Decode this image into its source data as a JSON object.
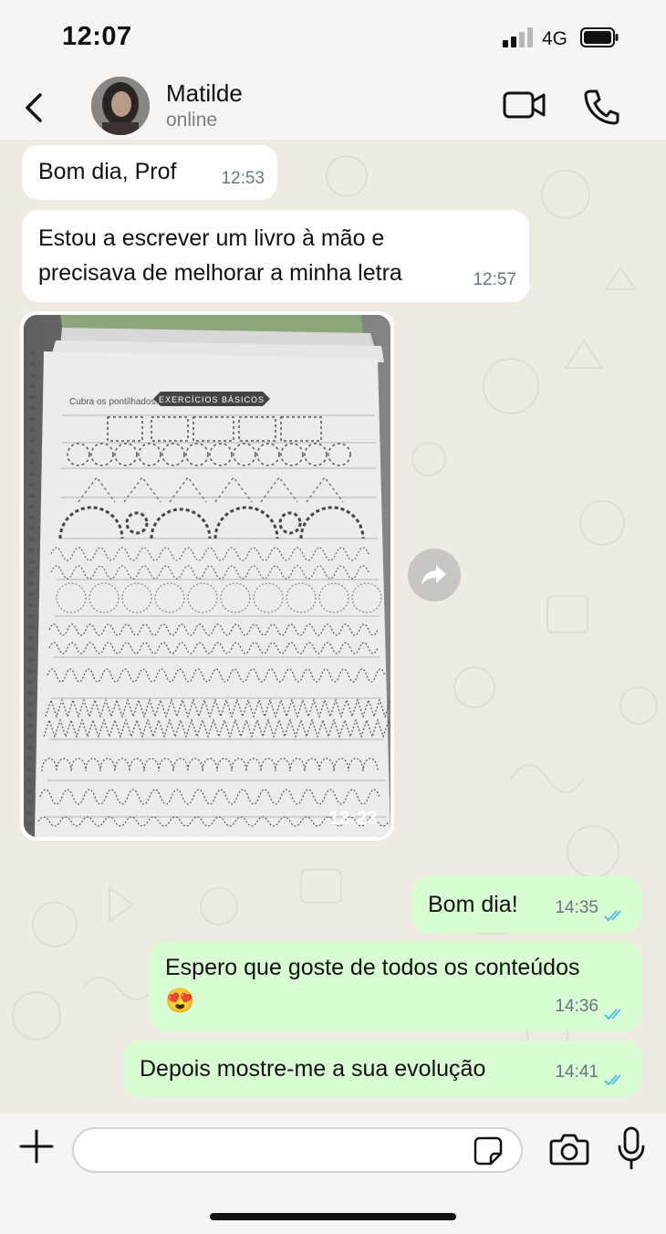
{
  "status_bar": {
    "time": "12:07",
    "network": "4G"
  },
  "header": {
    "contact_name": "Matilde",
    "contact_status": "online"
  },
  "messages": [
    {
      "direction": "incoming",
      "text": "Bom dia, Prof",
      "time": "12:53"
    },
    {
      "direction": "incoming",
      "text_lines": [
        "Estou a escrever um livro à mão e",
        "precisava de melhorar a minha letra"
      ],
      "time": "12:57"
    },
    {
      "direction": "incoming",
      "type": "image",
      "time": "13:23",
      "image_heading": "EXERCÍCIOS BÁSICOS",
      "image_instruction": "Cubra os pontilhados."
    },
    {
      "direction": "outgoing",
      "text": "Bom dia!",
      "time": "14:35",
      "status": "read"
    },
    {
      "direction": "outgoing",
      "text": "Espero que goste de todos os conteúdos",
      "emoji": "😍",
      "time": "14:36",
      "status": "read"
    },
    {
      "direction": "outgoing",
      "text": "Depois mostre-me a sua evolução",
      "time": "14:41",
      "status": "read"
    }
  ],
  "input": {
    "placeholder": ""
  },
  "colors": {
    "outgoing_bubble": "#d9fdd3",
    "incoming_bubble": "#ffffff",
    "read_ticks": "#53bdeb",
    "chat_background": "#efebe3"
  },
  "icons": [
    "back-arrow-icon",
    "video-call-icon",
    "phone-icon",
    "forward-icon",
    "plus-icon",
    "sticker-icon",
    "camera-icon",
    "microphone-icon"
  ]
}
